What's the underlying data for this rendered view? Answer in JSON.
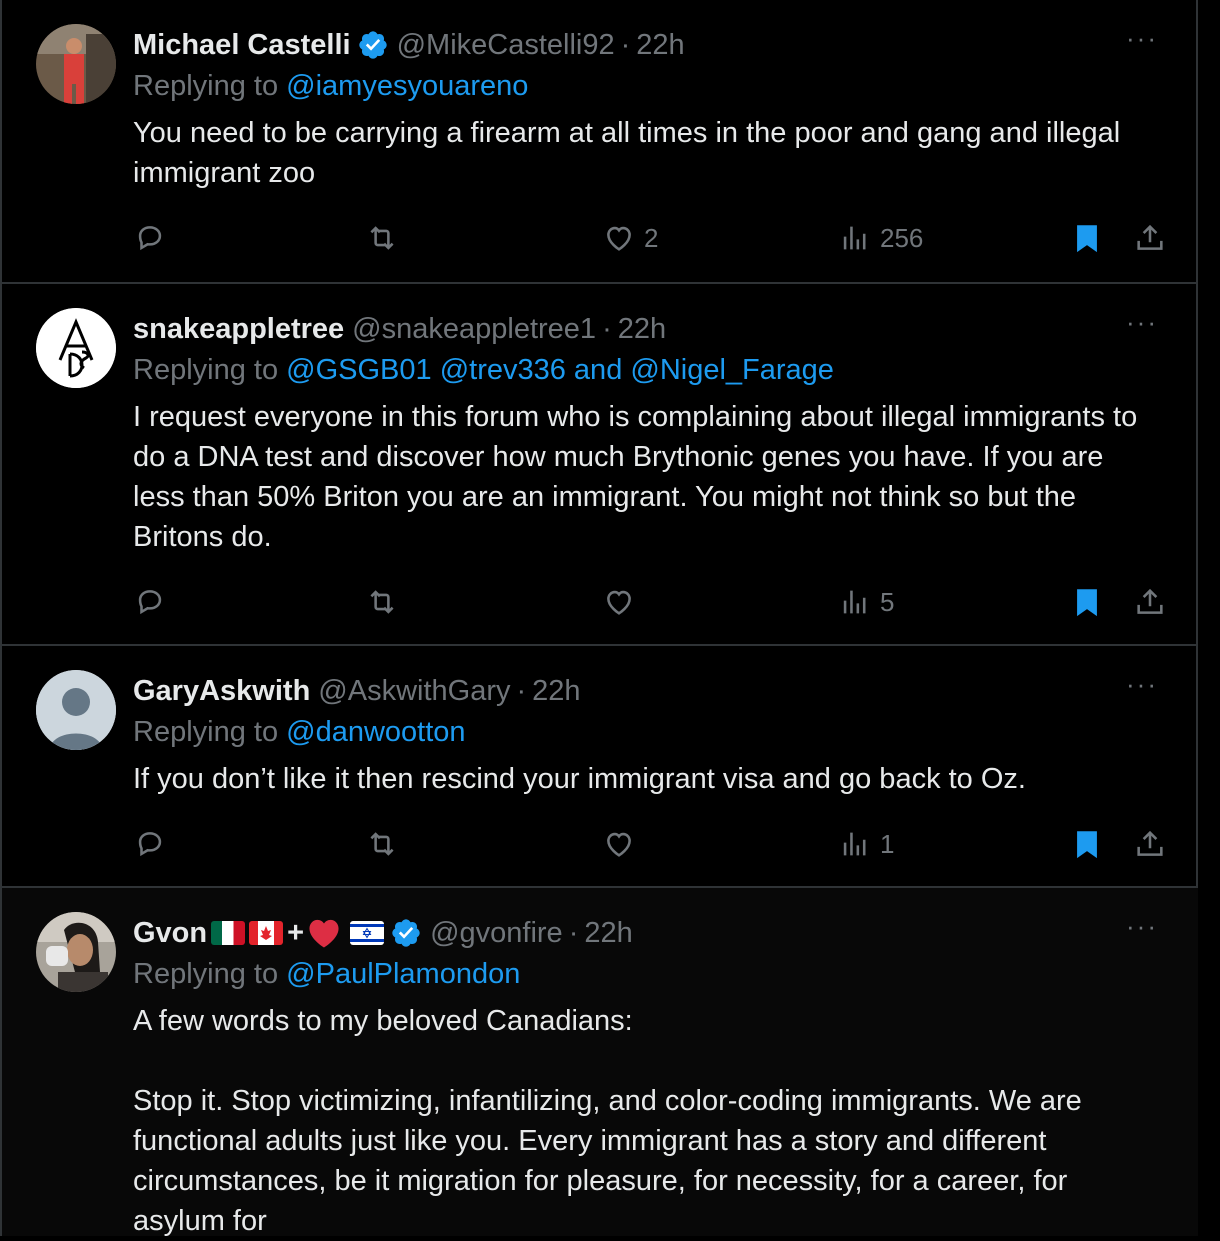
{
  "tweets": [
    {
      "name": "Michael Castelli",
      "handle": "@MikeCastelli92",
      "time": "22h",
      "replying_prefix": "Replying to",
      "replying_to": "@iamyesyouareno",
      "text": "You need to be carrying a firearm at all times in the poor and gang and illegal immigrant zoo",
      "likes": "2",
      "views": "256",
      "verified": true
    },
    {
      "name": "snakeappletree",
      "handle": "@snakeappletree1",
      "time": "22h",
      "replying_prefix": "Replying to",
      "replying_to": "@GSGB01 @trev336 and @Nigel_Farage",
      "text": "I request everyone in this forum who is complaining about illegal immigrants to do a DNA test and discover how much Brythonic genes you have. If you are less than 50% Briton you are an immigrant. You might not think so but the Britons do.",
      "likes": "",
      "views": "5",
      "verified": false
    },
    {
      "name": "GaryAskwith",
      "handle": "@AskwithGary",
      "time": "22h",
      "replying_prefix": "Replying to",
      "replying_to": "@danwootton",
      "text": "If you don’t like it then rescind your immigrant visa and go back to Oz.",
      "likes": "",
      "views": "1",
      "verified": false
    },
    {
      "name": "Gvon",
      "name_plus": "+",
      "handle": "@gvonfire",
      "time": "22h",
      "replying_prefix": "Replying to",
      "replying_to": "@PaulPlamondon",
      "text": "A few words to my beloved Canadians:\n\nStop it. Stop victimizing, infantilizing, and color-coding immigrants. We are functional adults just like you. Every immigrant has a story and different circumstances, be it migration for pleasure, for necessity, for a career, for asylum for",
      "verified": true
    }
  ],
  "sep": "·",
  "more": "···",
  "colors": {
    "accent": "#1d9bf0",
    "muted": "#71767b",
    "border": "#2f3336"
  },
  "icons": [
    "reply-icon",
    "retweet-icon",
    "like-icon",
    "views-icon",
    "bookmark-icon",
    "share-icon",
    "verified-icon",
    "more-icon"
  ]
}
